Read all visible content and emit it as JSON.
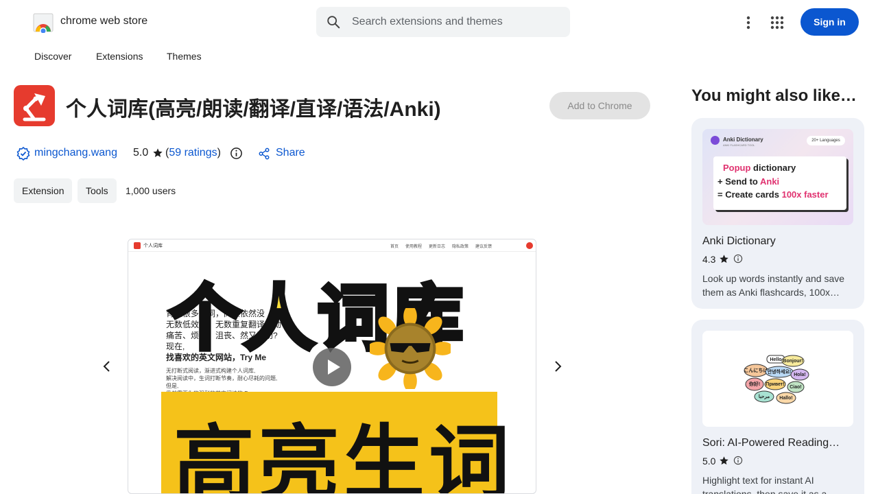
{
  "header": {
    "brand": "chrome web store",
    "search_placeholder": "Search extensions and themes",
    "sign_in": "Sign in"
  },
  "nav": [
    "Discover",
    "Extensions",
    "Themes"
  ],
  "item": {
    "title": "个人词库(高亮/朗读/翻译/直译/语法/Anki)",
    "add_button": "Add to Chrome",
    "developer": "mingchang.wang",
    "rating": "5.0",
    "ratings_open": "(",
    "ratings_count": "59 ratings",
    "ratings_close": ")",
    "share": "Share",
    "chips": [
      "Extension",
      "Tools"
    ],
    "users": "1,000 users",
    "accent": "#e63b2e"
  },
  "screenshot": {
    "mini_brand": "个人词库",
    "mini_nav": [
      "首页",
      "使用教程",
      "更新日志",
      "隐私政策",
      "建议反馈"
    ],
    "big_title": "个人词库",
    "big_subtitle": "高亮生词",
    "body_lines": [
      "背过很多单词，阅读依然没",
      "无数低效时，无数重复翻译劳动?",
      "痛苦、烦恼、沮丧、然又无助?",
      "现在,",
      "找喜欢的英文网站，Try Me"
    ],
    "small_lines": [
      "无打断式阅读，渐进式构建个人词库,",
      "解决阅读中，生词打断节奏，耐心尽耗的问题,",
      "但是,",
      "仍然需要你的强烈的英文阅读的 Pass"
    ]
  },
  "aside": {
    "title": "You might also like…",
    "cards": [
      {
        "name": "Anki Dictionary",
        "rating": "4.3",
        "desc": "Look up words instantly and save them as Anki flashcards, 100x…",
        "thumb": {
          "head": "Anki Dictionary",
          "sub": "ANKI FLASHCARD TOOL",
          "badge": "20+ Languages",
          "line1_a": "Popup",
          "line1_b": " dictionary",
          "line2_a": "+ Send to ",
          "line2_b": "Anki",
          "line3_a": "= Create cards ",
          "line3_b": "100x faster"
        }
      },
      {
        "name": "Sori: AI-Powered Reading…",
        "rating": "5.0",
        "desc": "Highlight text for instant AI translations, then save it as a…",
        "thumb": {
          "bubbles": [
            "Hello",
            "Bonjour!",
            "こんにちは",
            "안녕하세요!",
            "Hola!",
            "你好!",
            "Привет!",
            "Ciao!",
            "مرحبا",
            "Hallo!"
          ]
        }
      }
    ]
  }
}
